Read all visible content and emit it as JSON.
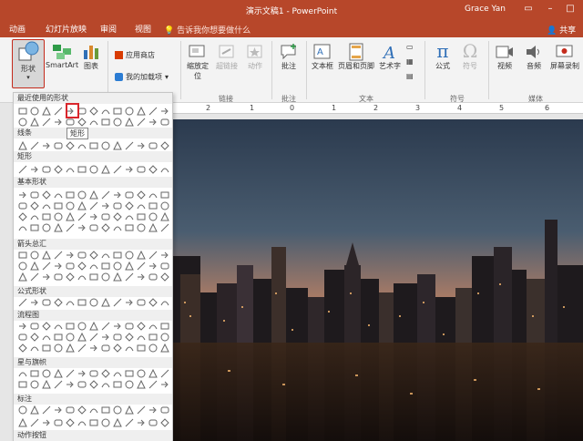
{
  "titlebar": {
    "title": "演示文稿1 - PowerPoint",
    "user": "Grace Yan"
  },
  "tabs": [
    "动画",
    "幻灯片放映",
    "审阅",
    "视图"
  ],
  "tell_me": "告诉我你想要做什么",
  "share": "共享",
  "ribbon": {
    "shapes": "形状",
    "smartart": "SmartArt",
    "chart": "图表",
    "app_store": "应用商店",
    "my_addins": "我的加载项",
    "zoom_to": "缩放定位",
    "hyperlink": "超链接",
    "action": "动作",
    "comment": "批注",
    "textbox": "文本框",
    "header_footer": "页眉和页脚",
    "wordart": "艺术字",
    "equation": "公式",
    "symbol": "符号",
    "video": "视频",
    "audio": "音频",
    "screen_record": "屏幕录制",
    "groups": {
      "links": "链接",
      "comments": "批注",
      "text": "文本",
      "symbols": "符号",
      "media": "媒体"
    }
  },
  "ruler_numbers": [
    "2",
    "1",
    "0",
    "1",
    "2",
    "3",
    "4",
    "5",
    "6"
  ],
  "panel": {
    "sections": [
      "最近使用的形状",
      "线条",
      "矩形",
      "基本形状",
      "箭头总汇",
      "公式形状",
      "流程图",
      "星与旗帜",
      "标注",
      "动作按钮"
    ],
    "tooltip": "矩形"
  }
}
